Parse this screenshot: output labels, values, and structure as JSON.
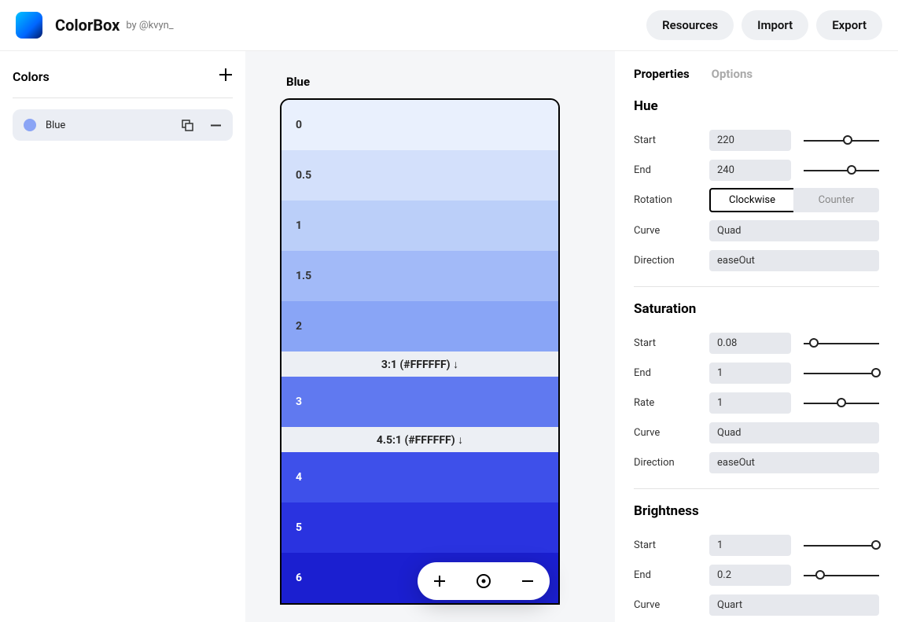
{
  "header": {
    "title": "ColorBox",
    "byline": "by @kvyn_",
    "resources": "Resources",
    "import": "Import",
    "export": "Export"
  },
  "sidebar": {
    "title": "Colors",
    "items": [
      {
        "name": "Blue",
        "swatch": "#8aa4f5"
      }
    ]
  },
  "canvas": {
    "title": "Blue",
    "shades": [
      {
        "label": "0",
        "bg": "#e9f0fd",
        "text": "dark"
      },
      {
        "label": "0.5",
        "bg": "#d3e0fb",
        "text": "dark"
      },
      {
        "label": "1",
        "bg": "#bbcff9",
        "text": "dark"
      },
      {
        "label": "1.5",
        "bg": "#a2baf8",
        "text": "dark"
      },
      {
        "label": "2",
        "bg": "#89a5f6",
        "text": "dark"
      },
      {
        "contrast": "3:1 (#FFFFFF) ↓"
      },
      {
        "label": "3",
        "bg": "#6079f0",
        "text": "light"
      },
      {
        "contrast": "4.5:1 (#FFFFFF) ↓"
      },
      {
        "label": "4",
        "bg": "#3e50ea",
        "text": "light"
      },
      {
        "label": "5",
        "bg": "#2a33e0",
        "text": "light"
      },
      {
        "label": "6",
        "bg": "#1b1fd0",
        "text": "light"
      }
    ]
  },
  "panel": {
    "tabs": {
      "properties": "Properties",
      "options": "Options"
    },
    "hue": {
      "title": "Hue",
      "startLabel": "Start",
      "startVal": "220",
      "startPos": 58,
      "endLabel": "End",
      "endVal": "240",
      "endPos": 64,
      "rotationLabel": "Rotation",
      "cw": "Clockwise",
      "ccw": "Counter",
      "curveLabel": "Curve",
      "curveVal": "Quad",
      "dirLabel": "Direction",
      "dirVal": "easeOut"
    },
    "sat": {
      "title": "Saturation",
      "startLabel": "Start",
      "startVal": "0.08",
      "startPos": 14,
      "endLabel": "End",
      "endVal": "1",
      "endPos": 96,
      "rateLabel": "Rate",
      "rateVal": "1",
      "ratePos": 50,
      "curveLabel": "Curve",
      "curveVal": "Quad",
      "dirLabel": "Direction",
      "dirVal": "easeOut"
    },
    "bri": {
      "title": "Brightness",
      "startLabel": "Start",
      "startVal": "1",
      "startPos": 96,
      "endLabel": "End",
      "endVal": "0.2",
      "endPos": 22,
      "curveLabel": "Curve",
      "curveVal": "Quart"
    }
  }
}
